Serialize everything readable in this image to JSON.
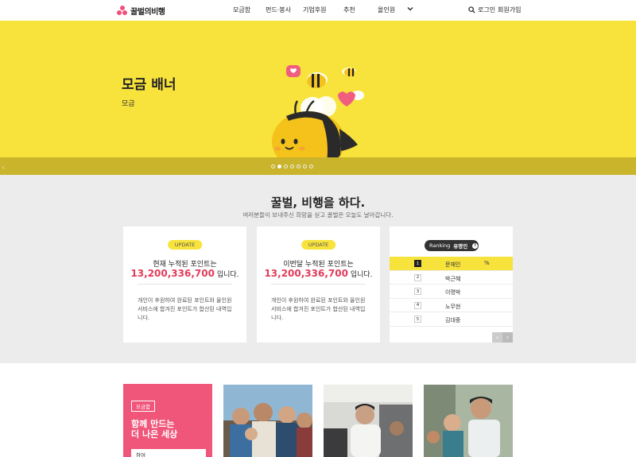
{
  "header": {
    "logo_text": "꿀벌의비행",
    "nav": [
      "모금함",
      "펀드·봉사",
      "기업후원",
      "추천",
      "올인원"
    ],
    "login": "로그인",
    "signup": "회원가입"
  },
  "hero": {
    "title": "모금 배너",
    "subtitle": "모금",
    "slide_count": 7,
    "active_slide": 2
  },
  "stats": {
    "title": "꿀벌, 비행을 하다.",
    "subtitle": "여러분들이 보내주신 희망을 싣고 꿀벌은 오늘도 날아갑니다.",
    "cards": [
      {
        "badge": "UPDATE",
        "line1": "현재 누적된 포인트는",
        "amount": "13,200,336,700",
        "suffix": "입니다.",
        "desc": "개인이 후원하여 완료된 포인트와 올인원 서비스에 합겨진 포인트가 합산된 내역입니다."
      },
      {
        "badge": "UPDATE",
        "line1": "이번달 누적된 포인트는",
        "amount": "13,200,336,700",
        "suffix": "입니다.",
        "desc": "개인이 후원하여 완료된 포인트와 올인원 서비스에 합겨진 포인트가 합산된 내역입니다."
      }
    ],
    "ranking": {
      "label": "Ranking",
      "category": "유명인",
      "rows": [
        {
          "rank": "1",
          "name": "문재인",
          "trend": "%"
        },
        {
          "rank": "2",
          "name": "박근혜",
          "trend": ""
        },
        {
          "rank": "3",
          "name": "이명박",
          "trend": ""
        },
        {
          "rank": "4",
          "name": "노무현",
          "trend": ""
        },
        {
          "rank": "5",
          "name": "김대중",
          "trend": ""
        }
      ]
    }
  },
  "bottom": {
    "badge": "모금함",
    "title_line1": "함께 만드는",
    "title_line2": "더 나은 세상",
    "button": "참여"
  },
  "colors": {
    "brand_yellow": "#f7e33c",
    "brand_pink": "#f0557a",
    "amount_red": "#e23b5a"
  },
  "icons": {
    "search": "search-icon",
    "chevron": "chevron-down-icon"
  }
}
